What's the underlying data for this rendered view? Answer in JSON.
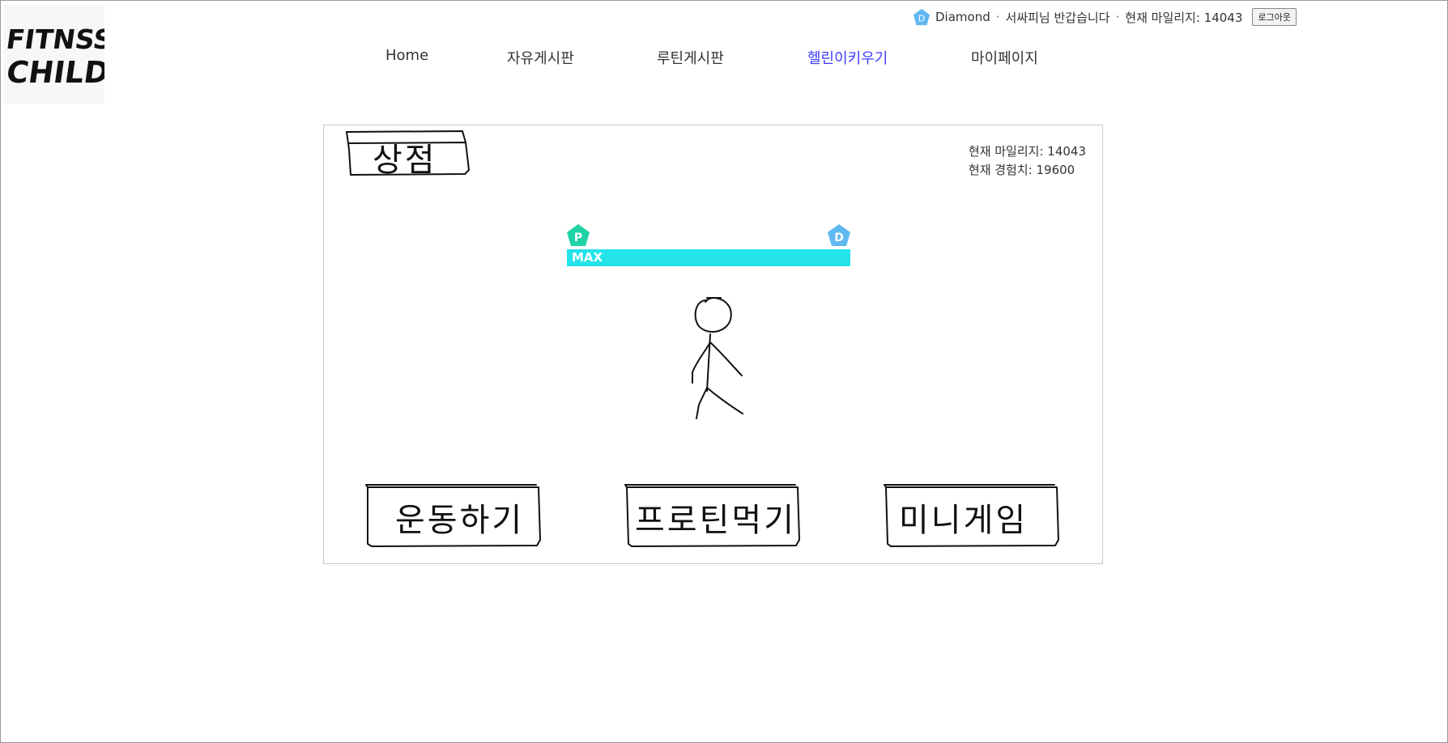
{
  "logo": {
    "line1": "FITNSS",
    "line2": "CHILD"
  },
  "userbar": {
    "tier_name": "Diamond",
    "tier_letter": "D",
    "greeting": "서싸피님 반갑습니다",
    "mileage_label": "현재 마일리지: 14043",
    "logout_label": "로그아웃",
    "separator": "·"
  },
  "nav": {
    "items": [
      {
        "label": "Home"
      },
      {
        "label": "자유게시판"
      },
      {
        "label": "루틴게시판"
      },
      {
        "label": "헬린이키우기"
      },
      {
        "label": "마이페이지"
      }
    ],
    "active_index": 3
  },
  "game": {
    "shop_label": "상점",
    "stats": {
      "mileage": "현재 마일리지: 14043",
      "exp": "현재 경험치: 19600"
    },
    "exp_bar": {
      "label": "MAX",
      "progress": 1.0,
      "from_tier": "P",
      "to_tier": "D"
    },
    "actions": [
      {
        "label": "운동하기"
      },
      {
        "label": "프로틴먹기"
      },
      {
        "label": "미니게임"
      }
    ]
  },
  "colors": {
    "accent_nav": "#3b3bff",
    "exp_fill": "#24e3ea",
    "tier_platinum": "#1fd3a6",
    "tier_diamond": "#5fb8f0"
  }
}
